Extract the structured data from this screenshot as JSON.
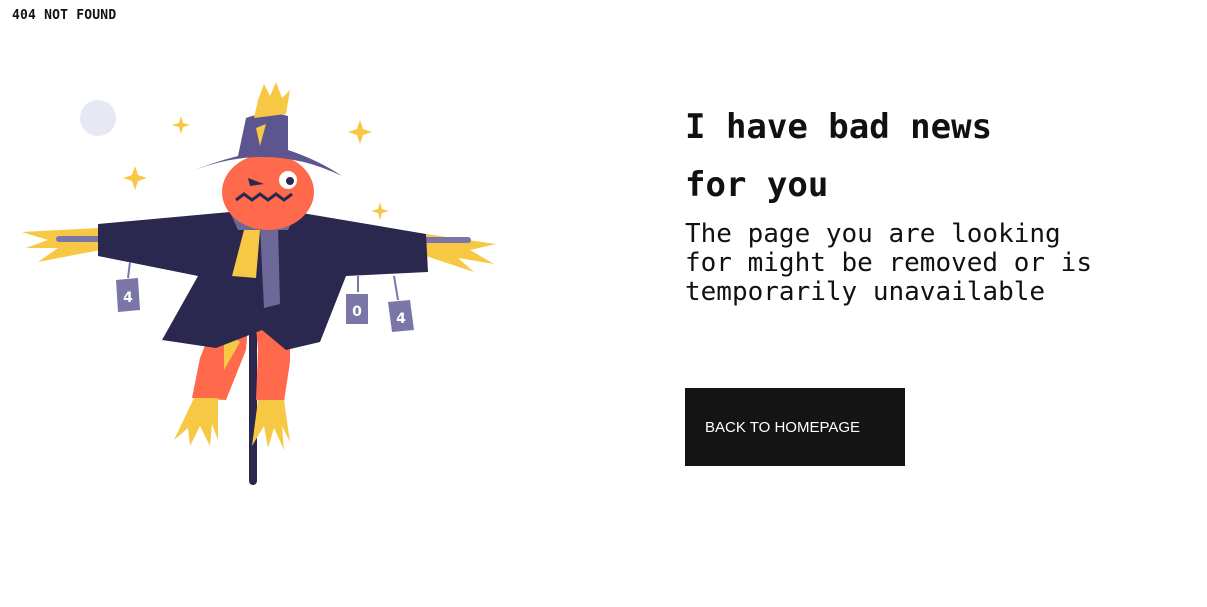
{
  "header": {
    "label": "404 NOT FOUND"
  },
  "illustration": {
    "icon": "scarecrow-404-illustration",
    "can_digits": [
      "4",
      "0",
      "4"
    ],
    "colors": {
      "hat": "#5c5590",
      "coat": "#2b2850",
      "face": "#ff6a4d",
      "straw": "#f7c843",
      "scarf": "#6d6899",
      "can": "#7a76a8",
      "moon": "#e6e8f3"
    }
  },
  "main": {
    "headline_line1": "I have bad news",
    "headline_line2": "for you",
    "message_line1": "The page you are looking",
    "message_line2": "for might be removed or is",
    "message_line3": "temporarily unavailable",
    "button_label": "BACK TO HOMEPAGE"
  },
  "colors": {
    "button_bg": "#141414",
    "button_text": "#ffffff",
    "text": "#111111"
  }
}
